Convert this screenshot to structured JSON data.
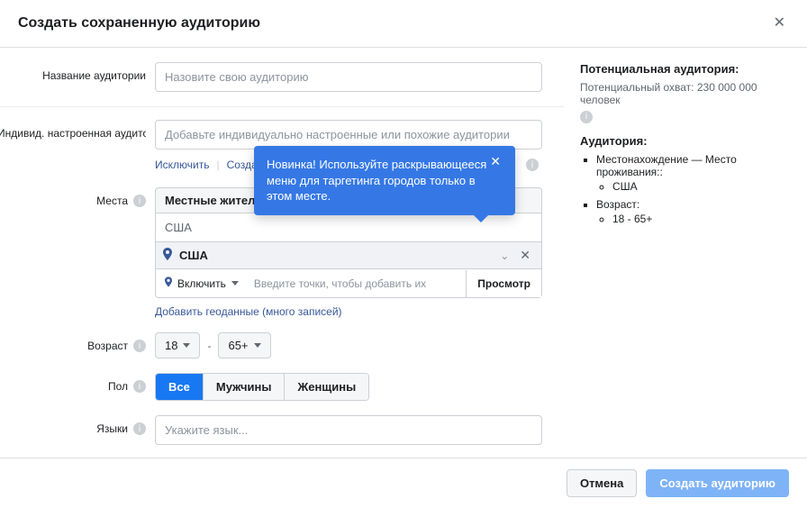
{
  "header": {
    "title": "Создать сохраненную аудиторию"
  },
  "fields": {
    "name_label": "Название аудитории",
    "name_placeholder": "Назовите свою аудиторию",
    "custom_label": "Индивид. настроенная аудитория",
    "custom_placeholder": "Добавьте индивидуально настроенные или похожие аудитории",
    "exclude_link": "Исключить",
    "create_link": "Создать",
    "places_label": "Места",
    "residents_option": "Местные жители",
    "country_group": "США",
    "selected_country": "США",
    "include_label": "Включить",
    "loc_placeholder": "Введите точки, чтобы добавить их",
    "browse_btn": "Просмотр",
    "geo_link": "Добавить геоданные (много записей)",
    "age_label": "Возраст",
    "age_min": "18",
    "age_max": "65+",
    "gender_label": "Пол",
    "gender_all": "Все",
    "gender_m": "Мужчины",
    "gender_f": "Женщины",
    "lang_label": "Языки",
    "lang_placeholder": "Укажите язык..."
  },
  "tooltip": {
    "text": "Новинка! Используйте раскрывающееся меню для таргетинга городов только в этом месте."
  },
  "sidebar": {
    "potential_heading": "Потенциальная аудитория:",
    "reach_text": "Потенциальный охват: 230 000 000 человек",
    "aud_heading": "Аудитория:",
    "loc_label": "Местонахождение — Место проживания::",
    "loc_value": "США",
    "age_label": "Возраст:",
    "age_value": "18 - 65+"
  },
  "footer": {
    "cancel": "Отмена",
    "create": "Создать аудиторию"
  }
}
